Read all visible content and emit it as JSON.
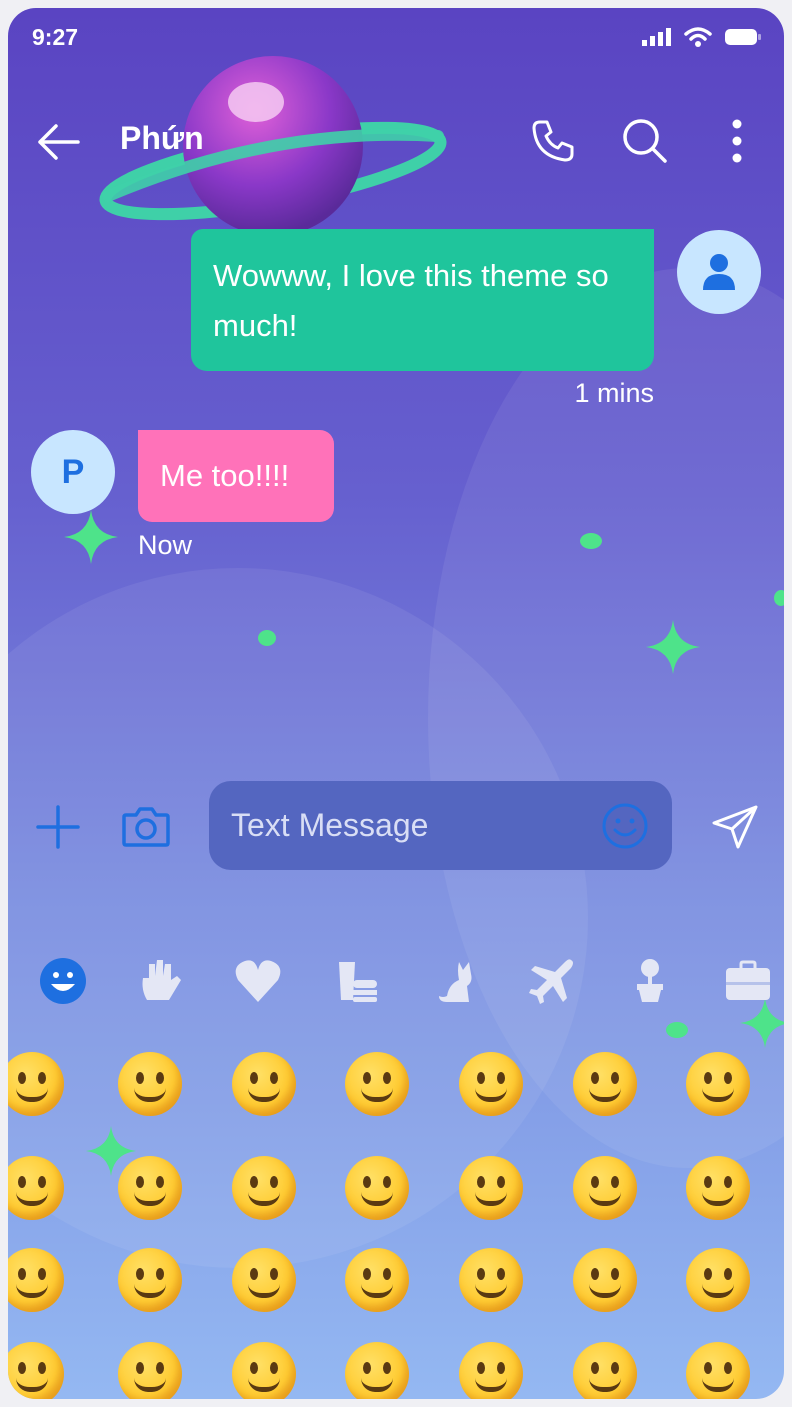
{
  "status_bar": {
    "time": "9:27"
  },
  "header": {
    "contact_name": "Phứn"
  },
  "messages": [
    {
      "direction": "outgoing",
      "text": "Wowww, I love this theme so much!",
      "time": "1 mins"
    },
    {
      "direction": "incoming",
      "avatar_letter": "P",
      "text": "Me too!!!!",
      "time": "Now"
    }
  ],
  "composer": {
    "placeholder": "Text Message"
  },
  "emoji_categories": [
    "smileys",
    "gestures",
    "hearts",
    "food",
    "animals",
    "travel",
    "nature",
    "objects"
  ],
  "emoji_rows": [
    [
      "🙂",
      "😀",
      "😁",
      "😆",
      "😅",
      "😂",
      "🤣"
    ],
    [
      "😊",
      "☺️",
      "😌",
      "😉",
      "😏",
      "😍",
      "😘"
    ],
    [
      "😗",
      "😙",
      "😚",
      "🤗",
      "😳",
      "🙃",
      "😭"
    ],
    [
      "😢",
      "😢",
      "😓",
      "😖",
      "😔",
      "😞",
      "☹️"
    ]
  ],
  "colors": {
    "outgoing_bubble": "#1fc59c",
    "incoming_bubble": "#ff72b9",
    "accent": "#1e6fe0",
    "sparkle": "#4ee38a"
  }
}
